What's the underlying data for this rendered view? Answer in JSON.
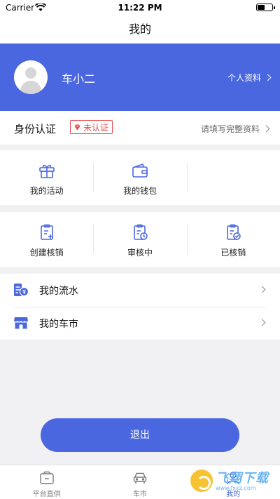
{
  "status_bar": {
    "carrier": "Carrier",
    "time": "11:22 PM"
  },
  "nav": {
    "title": "我的"
  },
  "profile": {
    "username": "车小二",
    "link_label": "个人资料"
  },
  "identity": {
    "title": "身份认证",
    "badge": "未认证",
    "link_label": "请填写完整资料"
  },
  "grid_row_1": {
    "items": [
      {
        "label": "我的活动",
        "icon": "gift-icon"
      },
      {
        "label": "我的钱包",
        "icon": "wallet-icon"
      }
    ]
  },
  "grid_row_2": {
    "items": [
      {
        "label": "创建核销",
        "icon": "clipboard-add-icon"
      },
      {
        "label": "审核中",
        "icon": "clipboard-clock-icon"
      },
      {
        "label": "已核销",
        "icon": "clipboard-check-icon"
      }
    ]
  },
  "menu": {
    "items": [
      {
        "label": "我的流水",
        "icon": "ledger-yen-icon"
      },
      {
        "label": "我的车市",
        "icon": "store-icon"
      }
    ]
  },
  "logout": {
    "label": "退出"
  },
  "tabbar": {
    "items": [
      {
        "label": "平台直供",
        "icon": "briefcase-icon"
      },
      {
        "label": "车市",
        "icon": "car-icon"
      },
      {
        "label": "我的",
        "icon": "user-icon",
        "active": true
      }
    ]
  },
  "watermark": {
    "title": "飞翔下载",
    "url": "www.fxxz.com"
  },
  "colors": {
    "accent": "#4a67e0",
    "warning": "#e84a4a",
    "background": "#f1f1f3"
  }
}
